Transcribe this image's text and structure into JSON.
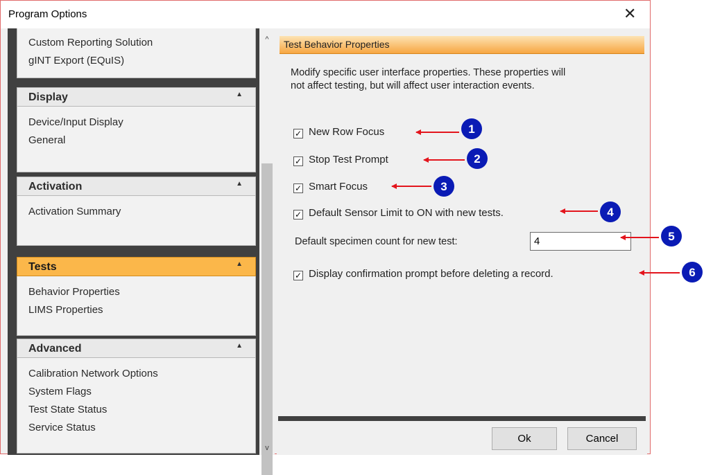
{
  "window": {
    "title": "Program Options",
    "close_glyph": "✕"
  },
  "nav": {
    "top_items": [
      "Custom Reporting Solution",
      "gINT Export (EQuIS)"
    ],
    "sections": [
      {
        "title": "Display",
        "items": [
          "Device/Input Display",
          "General"
        ],
        "active": false
      },
      {
        "title": "Activation",
        "items": [
          "Activation Summary"
        ],
        "active": false
      },
      {
        "title": "Tests",
        "items": [
          "Behavior Properties",
          "LIMS Properties"
        ],
        "active": true
      },
      {
        "title": "Advanced",
        "items": [
          "Calibration Network Options",
          "System Flags",
          "Test State Status",
          "Service Status"
        ],
        "active": false
      }
    ],
    "chevron_glyph": "▲",
    "scroll_up_glyph": "^",
    "scroll_down_glyph": "v"
  },
  "content": {
    "header": "Test Behavior Properties",
    "description": "Modify specific user interface properties.   These properties will not affect testing, but will affect user interaction events.",
    "options": [
      {
        "label": "New Row Focus",
        "checked": true
      },
      {
        "label": "Stop Test Prompt",
        "checked": true
      },
      {
        "label": "Smart Focus",
        "checked": true
      },
      {
        "label": "Default Sensor Limit to ON with new tests.",
        "checked": true
      },
      {
        "label": "Display confirmation prompt before deleting a record.",
        "checked": true
      }
    ],
    "specimen": {
      "label": "Default specimen count for new test:",
      "value": "4"
    },
    "buttons": {
      "ok": "Ok",
      "cancel": "Cancel"
    }
  },
  "annotations": {
    "markers": [
      "1",
      "2",
      "3",
      "4",
      "5",
      "6"
    ],
    "colors": {
      "marker": "#0a1bb5",
      "arrow": "#e3141c",
      "accent": "#fbb74a"
    }
  }
}
